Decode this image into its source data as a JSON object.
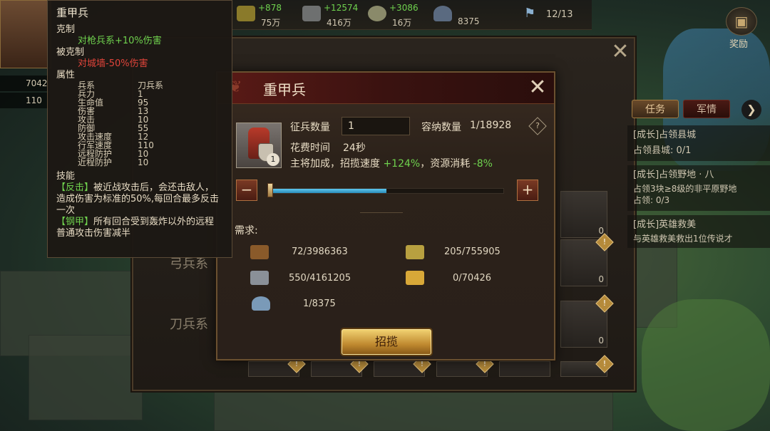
{
  "top_bar": {
    "resources": [
      {
        "name": "food-icon",
        "delta": "+878",
        "value": "75万"
      },
      {
        "name": "iron-icon",
        "delta": "+12574",
        "value": "416万"
      },
      {
        "name": "coin-icon",
        "delta": "+3086",
        "value": "16万"
      },
      {
        "name": "population-icon",
        "delta": "",
        "value": "8375"
      }
    ],
    "flag_count": "12/13",
    "gift_label": "奖励"
  },
  "left_panel": {
    "res_values": [
      "7042",
      "110"
    ]
  },
  "background_window": {
    "labels": [
      "弓兵系",
      "刀兵系"
    ],
    "slot_counts": [
      "0",
      "0",
      "0",
      "0"
    ]
  },
  "quest_panel": {
    "tabs": [
      "任务",
      "军情"
    ],
    "quests": [
      {
        "title": "[成长]占领县城",
        "detail": "占领县城: 0/1"
      },
      {
        "title": "[成长]占领野地 · 八",
        "detail": "占领3块≥8级的非平原野地",
        "progress": "占领: 0/3"
      },
      {
        "title": "[成长]英雄救美",
        "detail": "与英雄救美救出1位传说才"
      }
    ]
  },
  "tooltip": {
    "title": "重甲兵",
    "counter_header": "克制",
    "counter_text": "对枪兵系+10%伤害",
    "countered_header": "被克制",
    "countered_text": "对城墙-50%伤害",
    "attr_header": "属性",
    "attrs": [
      {
        "k": "兵系",
        "v": "刀兵系"
      },
      {
        "k": "兵力",
        "v": "1"
      },
      {
        "k": "生命值",
        "v": "95"
      },
      {
        "k": "伤害",
        "v": "13"
      },
      {
        "k": "攻击",
        "v": "10"
      },
      {
        "k": "防御",
        "v": "55"
      },
      {
        "k": "攻击速度",
        "v": "12"
      },
      {
        "k": "行军速度",
        "v": "110"
      },
      {
        "k": "远程防护",
        "v": "10"
      },
      {
        "k": "近程防护",
        "v": "10"
      }
    ],
    "skill_header": "技能",
    "skills": [
      {
        "name": "【反击】",
        "desc": "被近战攻击后，会还击敌人，造成伤害为标准的50%,每回合最多反击一次"
      },
      {
        "name": "【钢甲】",
        "desc": "所有回合受到轰炸以外的远程普通攻击伤害减半"
      }
    ]
  },
  "dialog": {
    "title": "重甲兵",
    "unit_level": "1",
    "qty_label": "征兵数量",
    "qty_value": "1",
    "capacity_label": "容纳数量",
    "capacity_value": "1/18928",
    "time_label": "花费时间",
    "time_value": "24秒",
    "bonus_prefix": "主将加成，招揽速度",
    "bonus_speed": "+124%",
    "bonus_mid": "，资源消耗",
    "bonus_cost": "-8%",
    "slider_fraction": 0.5,
    "minus": "−",
    "plus": "+",
    "req_label": "需求:",
    "requirements": [
      {
        "icon": "wood-icon",
        "value": "72/3986363"
      },
      {
        "icon": "food-icon",
        "value": "205/755905"
      },
      {
        "icon": "iron-icon",
        "value": "550/4161205"
      },
      {
        "icon": "gold-icon",
        "value": "0/70426"
      },
      {
        "icon": "population-icon",
        "value": "1/8375"
      }
    ],
    "recruit_label": "招揽"
  }
}
